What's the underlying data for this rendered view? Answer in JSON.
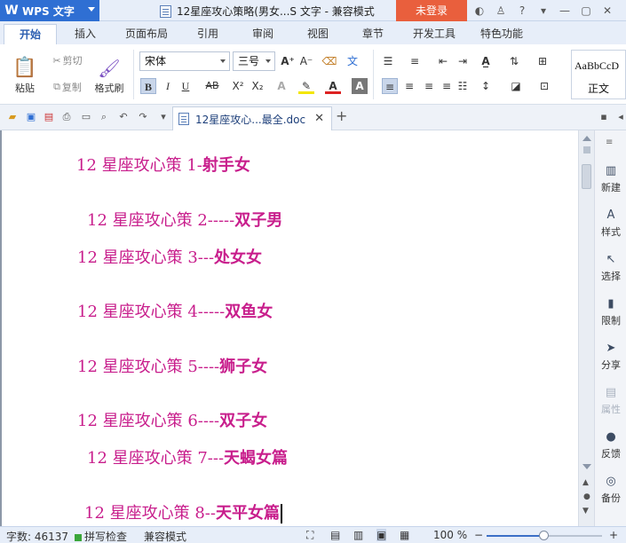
{
  "app": {
    "name": "WPS 文字",
    "logo": "W",
    "window_title": "12星座攻心策略(男女...S 文字 - 兼容模式",
    "login": "未登录"
  },
  "title_icons": [
    "settings-icon",
    "shirt-icon",
    "help-icon",
    "more-icon",
    "minimize-icon",
    "restore-icon",
    "close-icon"
  ],
  "tabs": [
    "开始",
    "插入",
    "页面布局",
    "引用",
    "审阅",
    "视图",
    "章节",
    "开发工具",
    "特色功能"
  ],
  "active_tab": "开始",
  "ribbon": {
    "paste": "粘贴",
    "cut": "剪切",
    "copy": "复制",
    "format_painter": "格式刷",
    "font_name": "宋体",
    "font_size": "三号",
    "bold": "B",
    "italic": "I",
    "underline": "U",
    "strike": "AB",
    "superscript": "X²",
    "subscript": "X₂",
    "style_sample": "AaBbCcD",
    "style_name": "正文"
  },
  "doc_tab": {
    "name": "12星座攻心...最全.doc"
  },
  "document": {
    "lines": [
      {
        "prefix": "12 星座攻心策 1-",
        "bold": "射手女"
      },
      {
        "prefix": "12 星座攻心策 2-----",
        "bold": "双子男"
      },
      {
        "prefix": "12 星座攻心策 3---",
        "bold": "处女女"
      },
      {
        "prefix": "12 星座攻心策 4-----",
        "bold": "双鱼女"
      },
      {
        "prefix": "12 星座攻心策 5----",
        "bold": "狮子女"
      },
      {
        "prefix": "12 星座攻心策 6----",
        "bold": "双子女"
      },
      {
        "prefix": "12 星座攻心策 7---",
        "bold": "天蝎女篇"
      },
      {
        "prefix": "12 星座攻心策 8--",
        "bold": "天平女篇"
      }
    ]
  },
  "side_pane": [
    "新建",
    "样式",
    "选择",
    "限制",
    "分享",
    "属性",
    "反馈",
    "备份"
  ],
  "status": {
    "word_count": "字数: 46137",
    "spell_check": "拼写检查",
    "mode": "兼容模式",
    "zoom": "100 %",
    "zoom_fraction": 0.5
  },
  "colors": {
    "accent": "#2f6fd3",
    "login": "#e95f3d",
    "text_magenta": "#c81e8c"
  }
}
